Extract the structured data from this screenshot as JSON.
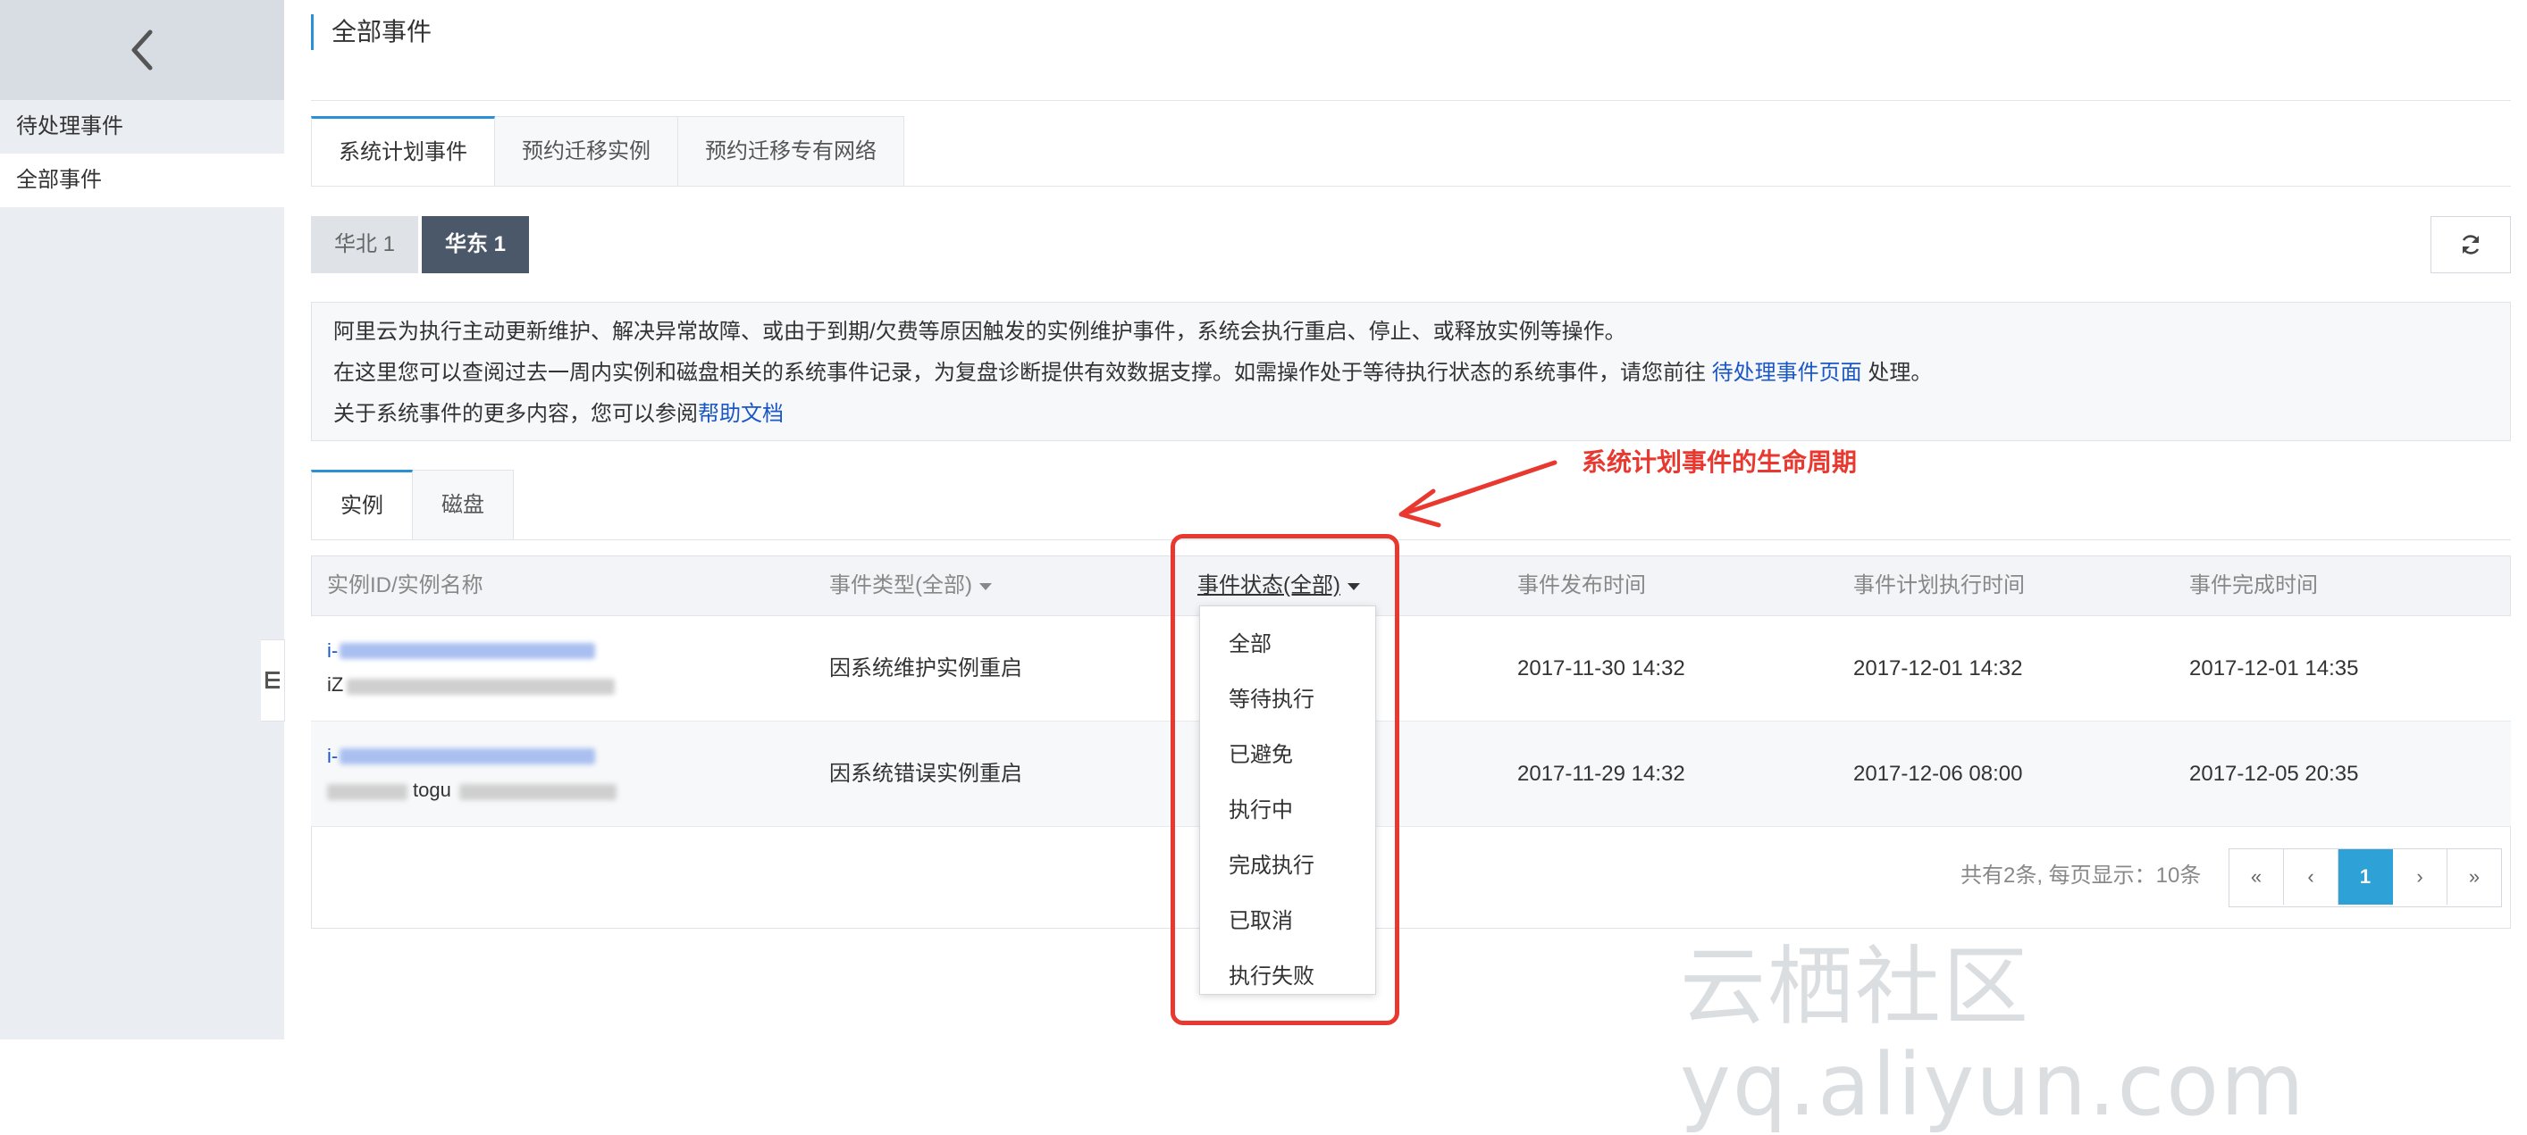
{
  "sidebar": {
    "items": [
      {
        "label": "待处理事件"
      },
      {
        "label": "全部事件"
      }
    ]
  },
  "page": {
    "title": "全部事件"
  },
  "tabs": [
    {
      "label": "系统计划事件"
    },
    {
      "label": "预约迁移实例"
    },
    {
      "label": "预约迁移专有网络"
    }
  ],
  "regions": [
    {
      "label": "华北 1"
    },
    {
      "label": "华东 1"
    }
  ],
  "info": {
    "line1": "阿里云为执行主动更新维护、解决异常故障、或由于到期/欠费等原因触发的实例维护事件，系统会执行重启、停止、或释放实例等操作。",
    "line2_prefix": "在这里您可以查阅过去一周内实例和磁盘相关的系统事件记录，为复盘诊断提供有效数据支撑。如需操作处于等待执行状态的系统事件，请您前往 ",
    "line2_link": "待处理事件页面",
    "line2_suffix": " 处理。",
    "line3_prefix": "关于系统事件的更多内容，您可以参阅",
    "line3_link": "帮助文档"
  },
  "subtabs": [
    {
      "label": "实例"
    },
    {
      "label": "磁盘"
    }
  ],
  "table": {
    "columns": {
      "id": "实例ID/实例名称",
      "type": "事件类型(全部)",
      "status": "事件状态(全部)",
      "published": "事件发布时间",
      "planned": "事件计划执行时间",
      "completed": "事件完成时间"
    },
    "rows": [
      {
        "id_prefix": "i-",
        "name_prefix": "iZ",
        "type": "因系统维护实例重启",
        "published": "2017-11-30 14:32",
        "planned": "2017-12-01 14:32",
        "completed": "2017-12-01 14:35"
      },
      {
        "id_prefix": "i-",
        "name_fragment": "togu",
        "type": "因系统错误实例重启",
        "published": "2017-11-29 14:32",
        "planned": "2017-12-06 08:00",
        "completed": "2017-12-05 20:35"
      }
    ],
    "summary": "共有2条, 每页显示：10条"
  },
  "pager": {
    "first": "«",
    "prev": "‹",
    "current": "1",
    "next": "›",
    "last": "»"
  },
  "status_dropdown": {
    "options": [
      "全部",
      "等待执行",
      "已避免",
      "执行中",
      "完成执行",
      "已取消",
      "执行失败"
    ]
  },
  "annotation": {
    "text": "系统计划事件的生命周期",
    "color": "#e8382f"
  },
  "watermark": "云栖社区 yq.aliyun.com",
  "colors": {
    "accent": "#2b91d6",
    "active_region": "#4a5869",
    "pager_active": "#2ea2d6",
    "link": "#1a57c4"
  }
}
